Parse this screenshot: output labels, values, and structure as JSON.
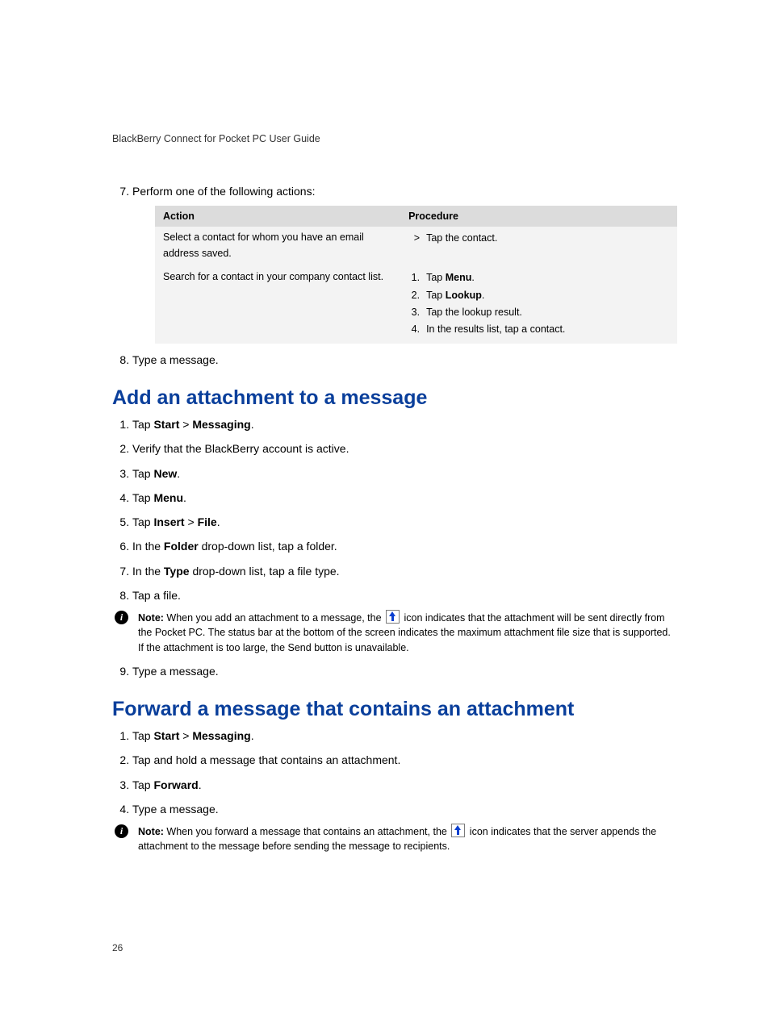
{
  "header": {
    "title": "BlackBerry Connect for Pocket PC User Guide"
  },
  "list7": {
    "num": "7.",
    "text": "Perform one of the following actions:"
  },
  "table": {
    "th_action": "Action",
    "th_proc": "Procedure",
    "row1": {
      "action": "Select a contact for whom you have an email address saved.",
      "proc_marker": ">",
      "proc_text": "Tap the contact."
    },
    "row2": {
      "action": "Search for a contact in your company contact list.",
      "p1m": "1.",
      "p1a": "Tap ",
      "p1b": "Menu",
      "p1c": ".",
      "p2m": "2.",
      "p2a": "Tap ",
      "p2b": "Lookup",
      "p2c": ".",
      "p3m": "3.",
      "p3": "Tap the lookup result.",
      "p4m": "4.",
      "p4": "In the results list, tap a contact."
    }
  },
  "list8": {
    "num": "8.",
    "text": "Type a message."
  },
  "sectionA": {
    "title": "Add an attachment to a message",
    "s1": {
      "a": "Tap ",
      "b": "Start",
      "c": " > ",
      "d": "Messaging",
      "e": "."
    },
    "s2": "Verify that the BlackBerry account is active.",
    "s3": {
      "a": "Tap ",
      "b": "New",
      "c": "."
    },
    "s4": {
      "a": "Tap ",
      "b": "Menu",
      "c": "."
    },
    "s5": {
      "a": "Tap ",
      "b": "Insert",
      "c": " > ",
      "d": "File",
      "e": "."
    },
    "s6": {
      "a": "In the ",
      "b": "Folder",
      "c": " drop-down list, tap a folder."
    },
    "s7": {
      "a": "In the ",
      "b": "Type",
      "c": " drop-down list, tap a file type."
    },
    "s8": "Tap a file.",
    "note": {
      "label": "Note:",
      "t1": " When you add an attachment to a message, the ",
      "t2": " icon indicates that the attachment will be sent directly from the Pocket PC. The status bar at the bottom of the screen indicates the maximum attachment file size that is supported. If the attachment is too large, the Send button is unavailable."
    },
    "s9": "Type a message."
  },
  "sectionB": {
    "title": "Forward a message that contains an attachment",
    "s1": {
      "a": "Tap ",
      "b": "Start",
      "c": " > ",
      "d": "Messaging",
      "e": "."
    },
    "s2": "Tap and hold a message that contains an attachment.",
    "s3": {
      "a": "Tap ",
      "b": "Forward",
      "c": "."
    },
    "s4": "Type a message.",
    "note": {
      "label": "Note:",
      "t1": " When you forward a message that contains an attachment, the ",
      "t2": " icon indicates that the server appends the attachment to the message before sending the message to recipients."
    }
  },
  "pageNum": "26"
}
